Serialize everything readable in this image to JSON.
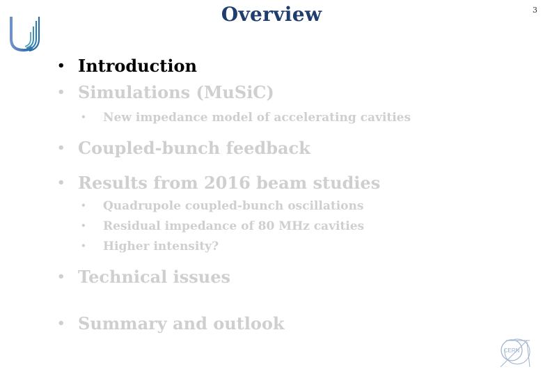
{
  "slide": {
    "title": "Overview",
    "page_number": "3",
    "accent_color": "#1f3e6e",
    "logo_icon": "university-u-logo",
    "footer_logo": "cern-logo",
    "footer_logo_text": "CERN"
  },
  "outline": [
    {
      "text": "Introduction",
      "level": 1,
      "active": true
    },
    {
      "text": "Simulations (MuSiC)",
      "level": 1,
      "active": false
    },
    {
      "text": "New impedance model of accelerating cavities",
      "level": 2,
      "active": false
    },
    {
      "text": "Coupled-bunch feedback",
      "level": 1,
      "active": false
    },
    {
      "text": "Results from 2016 beam studies",
      "level": 1,
      "active": false
    },
    {
      "text": "Quadrupole coupled-bunch oscillations",
      "level": 2,
      "active": false
    },
    {
      "text": "Residual impedance of 80 MHz cavities",
      "level": 2,
      "active": false
    },
    {
      "text": "Higher intensity?",
      "level": 2,
      "active": false
    },
    {
      "text": "Technical issues",
      "level": 1,
      "active": false
    },
    {
      "text": "Summary and outlook",
      "level": 1,
      "active": false
    }
  ],
  "bullet_glyph": "•"
}
